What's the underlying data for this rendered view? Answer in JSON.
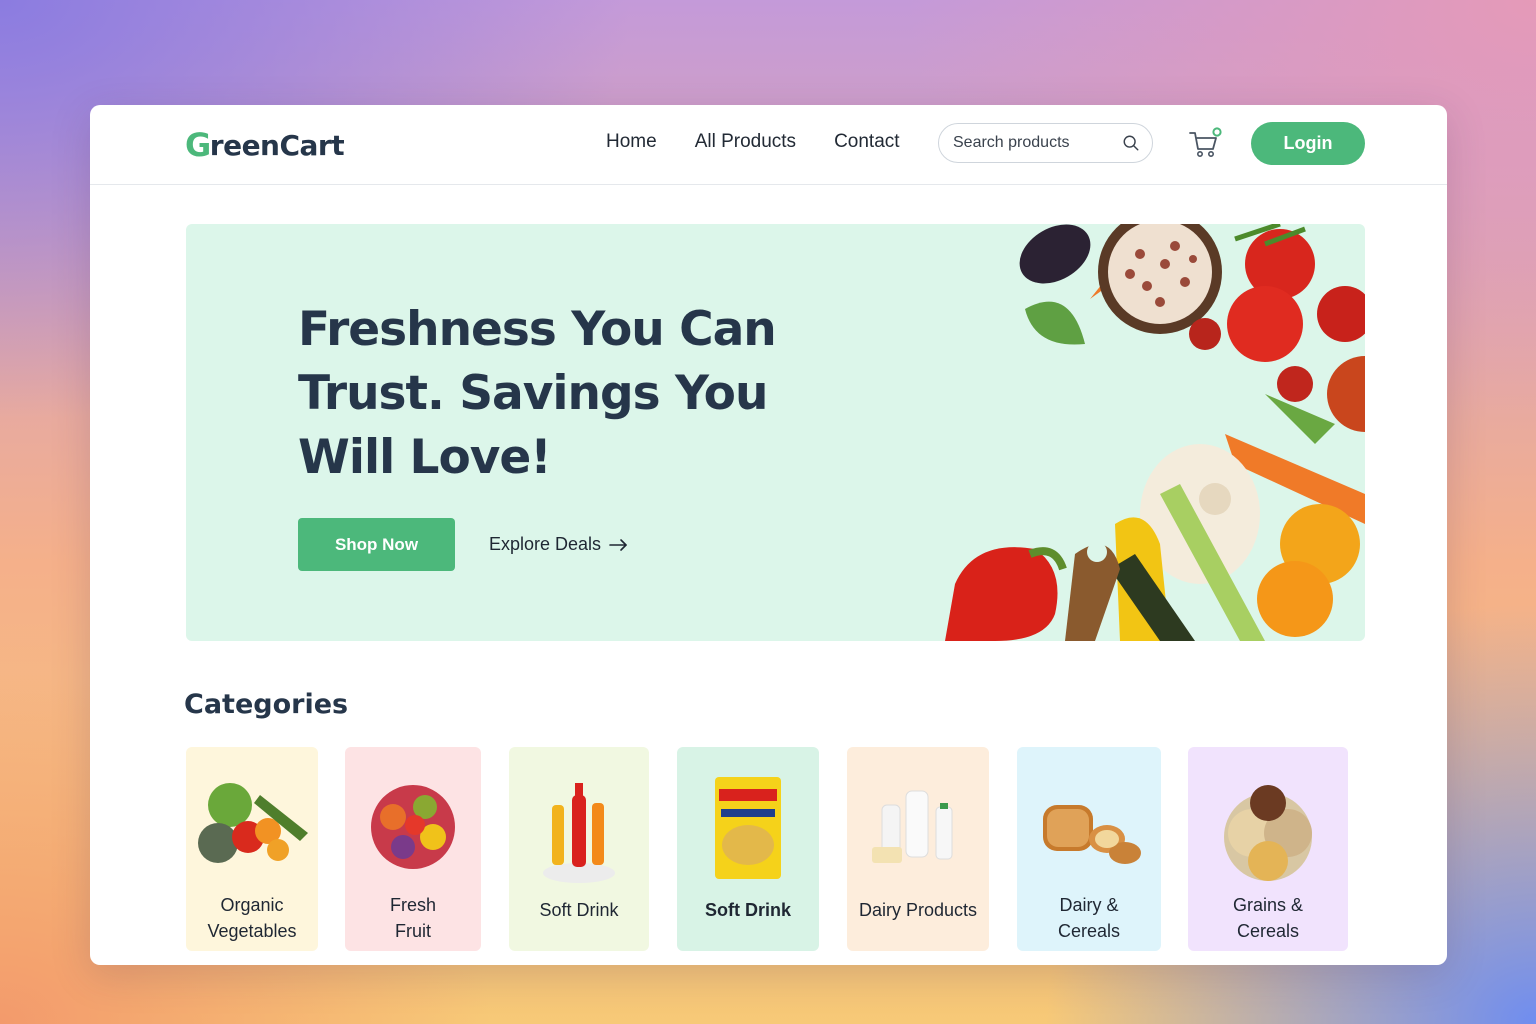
{
  "brand": {
    "logo_first": "G",
    "logo_rest": "reenCart"
  },
  "nav": {
    "items": [
      "Home",
      "All Products",
      "Contact"
    ]
  },
  "search": {
    "placeholder": "Search products"
  },
  "header": {
    "login_label": "Login"
  },
  "hero": {
    "title": "Freshness You Can Trust. Savings You Will Love!",
    "shop_label": "Shop Now",
    "explore_label": "Explore Deals"
  },
  "categories": {
    "title": "Categories",
    "items": [
      {
        "label": "Organic Vegetables",
        "bg": "#fef6dc"
      },
      {
        "label": "Fresh Fruit",
        "bg": "#fde3e4"
      },
      {
        "label": "Soft Drink",
        "bg": "#f1f8e1"
      },
      {
        "label": "Soft Drink",
        "bg": "#d8f3e6"
      },
      {
        "label": "Dairy Products",
        "bg": "#fdeddc"
      },
      {
        "label": "Dairy & Cereals",
        "bg": "#def4fb"
      },
      {
        "label": "Grains & Cereals",
        "bg": "#f1e3fd"
      }
    ]
  },
  "colors": {
    "accent": "#4cb87b",
    "heading": "#26364a",
    "hero_bg": "#dcf6ea"
  }
}
